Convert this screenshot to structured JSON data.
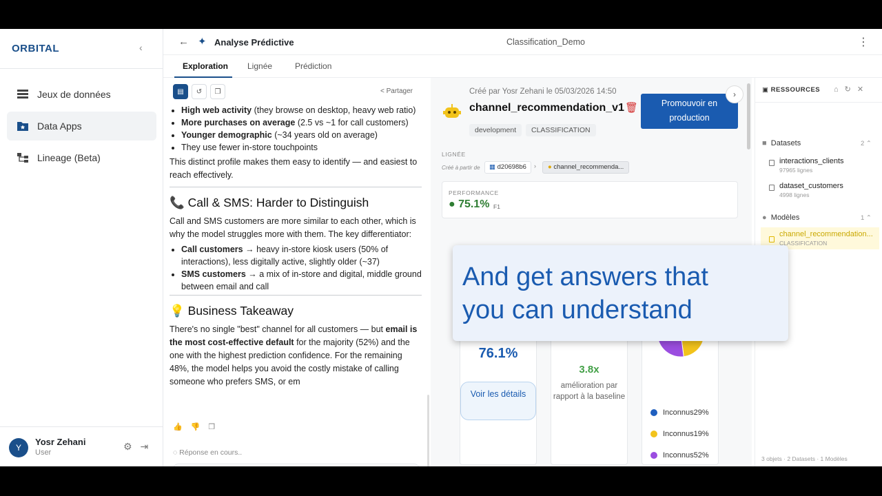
{
  "app": {
    "brand": "ORBITAL",
    "page_title": "Analyse Prédictive",
    "project_name": "Classification_Demo"
  },
  "sidebar": {
    "items": [
      {
        "label": "Jeux de données",
        "icon": "table-icon"
      },
      {
        "label": "Data Apps",
        "icon": "folder-star-icon",
        "active": true
      },
      {
        "label": "Lineage (Beta)",
        "icon": "lineage-icon"
      }
    ],
    "user": {
      "initial": "Y",
      "name": "Yosr Zehani",
      "role": "User"
    }
  },
  "tabs": [
    "Exploration",
    "Lignée",
    "Prédiction"
  ],
  "chat": {
    "share_label": "Partager",
    "bullets_top": [
      {
        "bold": "High web activity",
        "text": " (they browse on desktop, heavy web ratio)"
      },
      {
        "bold": "More purchases on average",
        "text": " (2.5 vs ~1 for call customers)"
      },
      {
        "bold": "Younger demographic",
        "text": " (~34 years old on average)"
      },
      {
        "bold": "",
        "text": "They use fewer in-store touchpoints"
      }
    ],
    "para1": "This distinct profile makes them easy to identify — and easiest to reach effectively.",
    "h_call": "📞 Call & SMS: Harder to Distinguish",
    "para2": "Call and SMS customers are more similar to each other, which is why the model struggles more with them. The key differentiator:",
    "bullets_call": [
      {
        "bold": "Call customers",
        "text": " → heavy in-store kiosk users (50% of interactions), less digitally active, slightly older (~37)"
      },
      {
        "bold": "SMS customers",
        "text": " → a mix of in-store and digital, middle ground between email and call"
      }
    ],
    "h_biz": "💡 Business Takeaway",
    "biz_a": "There's no single \"best\" channel for all customers — but ",
    "biz_b": "email is the most cost-effective default",
    "biz_c": " for the majority (52%) and the one with the highest prediction confidence. For the remaining 48%, the model helps you avoid the costly mistake of calling someone who prefers SMS, or em",
    "pending": "Réponse en cours..",
    "input_placeholder": "Réponse en cours..."
  },
  "model": {
    "created": "Créé par Yosr Zehani le 05/03/2026 14:50",
    "name": "channel_recommendation_v1",
    "promote_label": "Promouvoir en production",
    "chips": [
      "development",
      "CLASSIFICATION"
    ],
    "lineage_label": "LIGNÉE",
    "created_from": "Créé à partir de",
    "source_hash": "d20698b6",
    "model_chip": "channel_recommenda...",
    "performance_label": "PERFORMANCE",
    "performance_value": "75.1%",
    "performance_metric": "F1",
    "accuracy": "76.1%",
    "details_label": "Voir les détails",
    "lift": "3.8x",
    "lift_text": "amélioration par rapport à la baseline",
    "pie": [
      {
        "label": "Inconnus29%",
        "value": 29,
        "color": "#1f5fbf"
      },
      {
        "label": "Inconnus19%",
        "value": 19,
        "color": "#f2c31b"
      },
      {
        "label": "Inconnus52%",
        "value": 52,
        "color": "#9b4de0"
      }
    ]
  },
  "overlay": {
    "line1": "And get answers that",
    "line2": "you can understand"
  },
  "resources": {
    "title": "RESSOURCES",
    "datasets_label": "Datasets",
    "datasets_count": "2",
    "datasets": [
      {
        "name": "interactions_clients",
        "sub": "97965 lignes"
      },
      {
        "name": "dataset_customers",
        "sub": "4998 lignes"
      }
    ],
    "models_label": "Modèles",
    "models_count": "1",
    "models": [
      {
        "name": "channel_recommendation...",
        "sub": "CLASSIFICATION"
      }
    ],
    "footer": "3 objets · 2 Datasets · 1 Modèles"
  }
}
